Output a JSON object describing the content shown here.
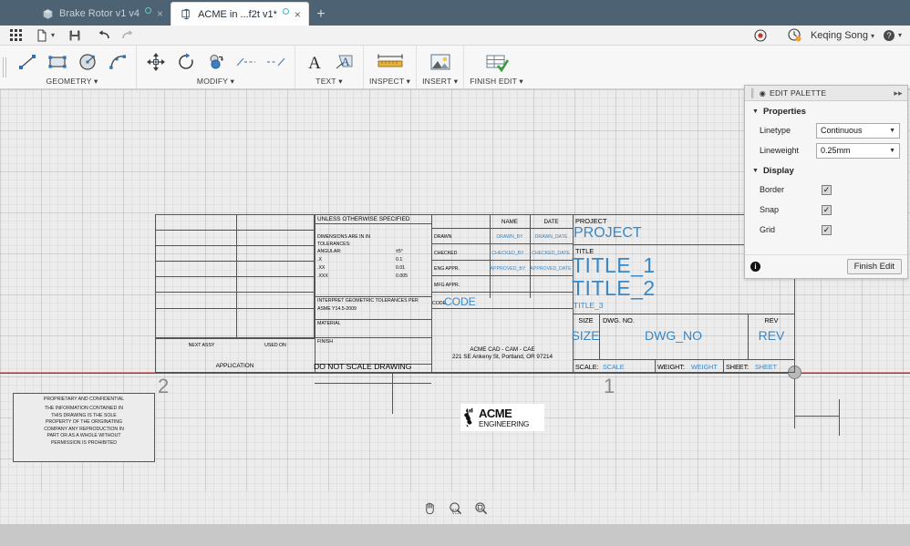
{
  "tabs": [
    {
      "label": "Brake Rotor v1 v4",
      "icon": "cube-icon",
      "active": false,
      "modified": false
    },
    {
      "label": "ACME in ...f2t v1*",
      "icon": "drawing-icon",
      "active": true,
      "modified": true
    }
  ],
  "tabbar": {
    "add_label": "+",
    "close_label": "×"
  },
  "quickbar": {
    "grid_menu": "grid-menu-icon",
    "new_doc": "new-document-icon",
    "save": "save-icon",
    "undo": "undo-icon",
    "redo": "redo-icon",
    "record": "record-icon",
    "history": "job-status-icon",
    "user": "Keqing Song",
    "help": "help-icon"
  },
  "ribbon": {
    "groups": [
      {
        "label": "GEOMETRY ▾",
        "buttons": [
          "line-tool",
          "rectangle-tool",
          "circle-tool",
          "arc-tool"
        ]
      },
      {
        "label": "MODIFY ▾",
        "buttons": [
          "move-tool",
          "rotate-tool",
          "offset-tool",
          "trim-tool",
          "extend-tool"
        ]
      },
      {
        "label": "TEXT ▾",
        "buttons": [
          "text-tool",
          "leader-text-tool"
        ]
      },
      {
        "label": "INSPECT ▾",
        "buttons": [
          "measure-tool"
        ]
      },
      {
        "label": "INSERT ▾",
        "buttons": [
          "insert-image-tool"
        ]
      },
      {
        "label": "FINISH EDIT ▾",
        "buttons": [
          "finish-edit-tool"
        ]
      }
    ]
  },
  "palette": {
    "title": "EDIT PALETTE",
    "pin_icon": "collapse-right-icon",
    "sections": {
      "properties": {
        "label": "Properties",
        "rows": [
          {
            "label": "Linetype",
            "value": "Continuous"
          },
          {
            "label": "Lineweight",
            "value": "0.25mm"
          }
        ]
      },
      "display": {
        "label": "Display",
        "rows": [
          {
            "label": "Border",
            "checked": true
          },
          {
            "label": "Snap",
            "checked": true
          },
          {
            "label": "Grid",
            "checked": true
          }
        ]
      }
    },
    "info_icon": "info-icon",
    "finish_button": "Finish Edit"
  },
  "nav": {
    "pan": "pan-hand-icon",
    "zoom_window": "zoom-window-icon",
    "zoom_fit": "zoom-fit-icon"
  },
  "sheet": {
    "zone_labels": [
      "2",
      "1"
    ],
    "proprietary": {
      "title": "PROPRIETARY AND CONFIDENTIAL",
      "line1": "THE INFORMATION CONTAINED IN",
      "line2": "THIS DRAWING IS THE SOLE",
      "line3": "PROPERTY OF THE ORIGINATING",
      "line4": "COMPANY ANY REPRODUCTION IN",
      "line5": "PART OR AS A WHOLE WITHOUT",
      "line6": "PERMISSION IS PROHIBITED"
    },
    "revision_table": {
      "next_assy": "NEXT ASSY",
      "used_on": "USED ON",
      "application": "APPLICATION"
    },
    "notes": {
      "unless": "UNLESS OTHERWISE SPECIFIED",
      "dimensions": "DIMENSIONS ARE IN IN",
      "tolerances": "TOLERANCES:",
      "angular_label": "ANGULAR:",
      "angular_value": "±5°",
      "x_label": ".X",
      "x_value": "0.1",
      "xx_label": ".XX",
      "xx_value": "0.01",
      "xxx_label": ".XXX",
      "xxx_value": "0.005",
      "interpret1": "INTERPRET GEOMETRIC TOLERANCES PER",
      "interpret2": "ASME Y14.5-2009",
      "material": "MATERIAL",
      "finish": "FINISH",
      "do_not_scale": "DO NOT SCALE DRAWING"
    },
    "signoff": {
      "name_header": "NAME",
      "date_header": "DATE",
      "rows": [
        {
          "label": "DRAWN",
          "name": "DRAWN_BY",
          "date": "DRAWN_DATE"
        },
        {
          "label": "CHECKED",
          "name": "CHECKED_BY",
          "date": "CHECKED_DATE"
        },
        {
          "label": "ENG APPR.",
          "name": "APPROVED_BY",
          "date": "APPROVED_DATE"
        },
        {
          "label": "MFG APPR.",
          "name": "",
          "date": ""
        }
      ],
      "code_label": "CODE",
      "code_value": "CODE"
    },
    "company": {
      "logo_word": "ACME",
      "logo_sub": "ENGINEERING",
      "line1": "ACME CAD - CAM - CAE",
      "line2": "221 SE Ankeny St, Portland, OR 97214"
    },
    "titleblock": {
      "project_label": "PROJECT",
      "project_value": "PROJECT",
      "title_label": "TITLE",
      "title_1": "TITLE_1",
      "title_2": "TITLE_2",
      "title_3": "TITLE_3",
      "size_label": "SIZE",
      "size_value": "SIZE",
      "dwg_label": "DWG.  NO.",
      "dwg_value": "DWG_NO",
      "rev_label": "REV",
      "rev_value": "REV",
      "scale_label": "SCALE:",
      "scale_value": "SCALE",
      "weight_label": "WEIGHT:",
      "weight_value": "WEIGHT",
      "sheet_label": "SHEET:",
      "sheet_value": "SHEET"
    }
  },
  "colors": {
    "accent_blue": "#3b87c4",
    "tabbar": "#4d6272",
    "canvas": "#ececec",
    "guide_red": "#d98a8a"
  }
}
